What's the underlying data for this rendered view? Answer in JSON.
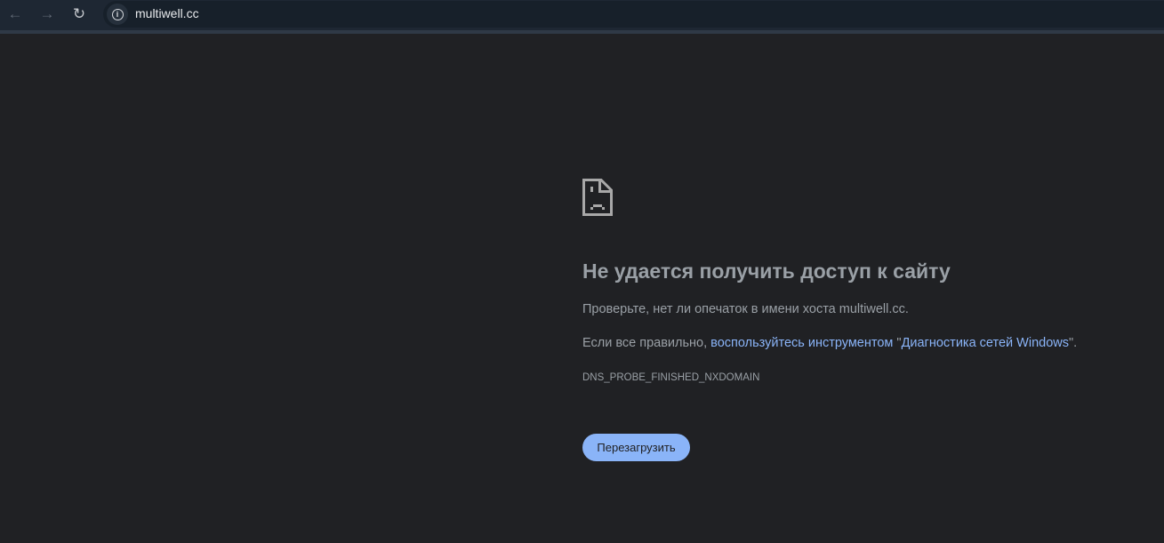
{
  "browser": {
    "url": "multiwell.cc"
  },
  "error": {
    "title": "Не удается получить доступ к сайту",
    "line1": "Проверьте, нет ли опечаток в имени хоста multiwell.cc.",
    "line2_prefix": "Если все правильно, ",
    "line2_link1": "воспользуйтесь инструментом",
    "line2_mid": " \"",
    "line2_link2": "Диагностика сетей Windows",
    "line2_suffix": "\".",
    "code": "DNS_PROBE_FINISHED_NXDOMAIN",
    "reload_label": "Перезагрузить"
  },
  "colors": {
    "accent": "#8ab4f8",
    "background": "#202124",
    "text": "#9aa0a6"
  }
}
